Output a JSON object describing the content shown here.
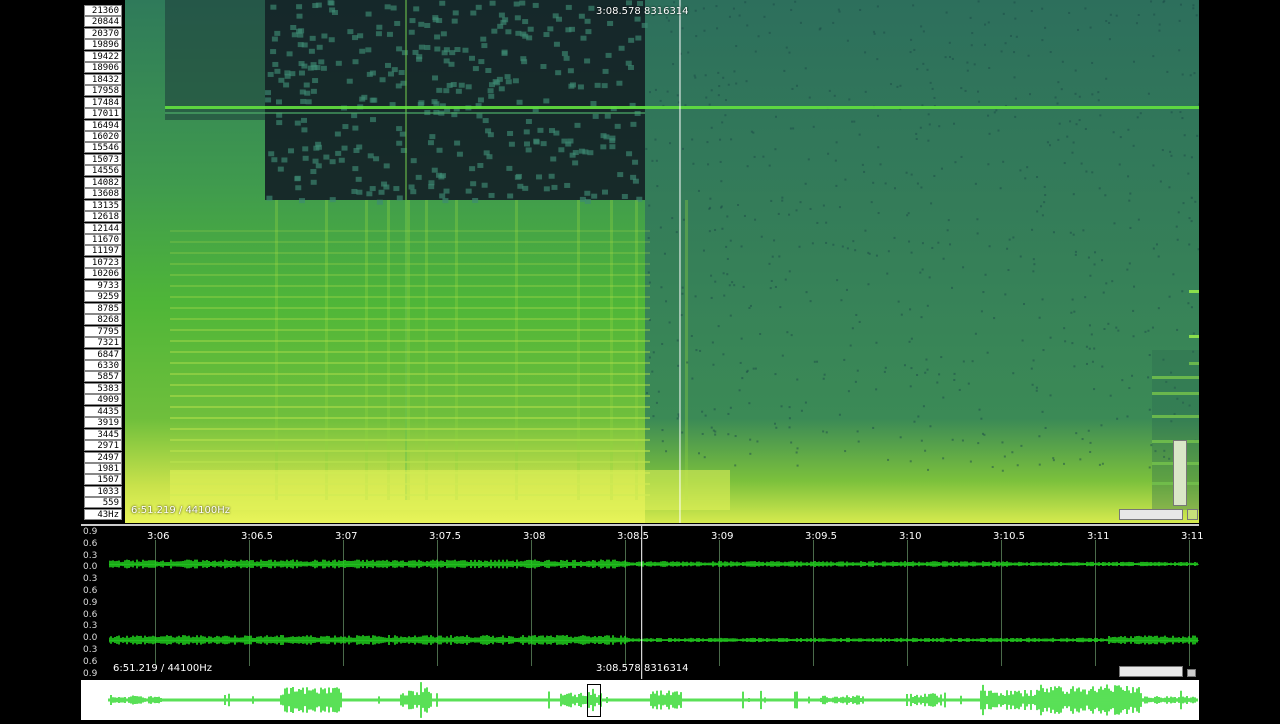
{
  "spectrogram": {
    "freq_ticks": [
      "21360",
      "20844",
      "20370",
      "19896",
      "19422",
      "18906",
      "18432",
      "17958",
      "17484",
      "17011",
      "16494",
      "16020",
      "15546",
      "15073",
      "14556",
      "14082",
      "13608",
      "13135",
      "12618",
      "12144",
      "11670",
      "11197",
      "10723",
      "10206",
      "9733",
      "9259",
      "8785",
      "8268",
      "7795",
      "7321",
      "6847",
      "6330",
      "5857",
      "5383",
      "4909",
      "4435",
      "3919",
      "3445",
      "2971",
      "2497",
      "1981",
      "1507",
      "1033",
      "559",
      "43Hz"
    ],
    "info_label": "6:51.219 / 44100Hz",
    "cursor_time": "3:08.578",
    "cursor_sample": "8316314",
    "cursor_fraction": 0.478
  },
  "timeline": {
    "amp_ticks": [
      "0.9",
      "0.6",
      "0.3",
      "0.0",
      "0.3",
      "0.6",
      "0.9",
      "0.6",
      "0.3",
      "0.0",
      "0.3",
      "0.6",
      "0.9"
    ],
    "time_labels": [
      "3:06",
      "3:06.5",
      "3:07",
      "3:07.5",
      "3:08",
      "3:08.5",
      "3:09",
      "3:09.5",
      "3:10",
      "3:10.5",
      "3:11",
      "3:11"
    ],
    "info_label": "6:51.219 / 44100Hz",
    "cursor_time": "3:08.578",
    "cursor_sample": "8316314"
  },
  "overview": {
    "position_fraction": 0.46
  },
  "colors": {
    "waveform": "#22d61f",
    "spec_low": "#e9f55a",
    "spec_mid": "#4fb638",
    "spec_base": "#2f7a5a",
    "spec_dark": "#142126"
  }
}
